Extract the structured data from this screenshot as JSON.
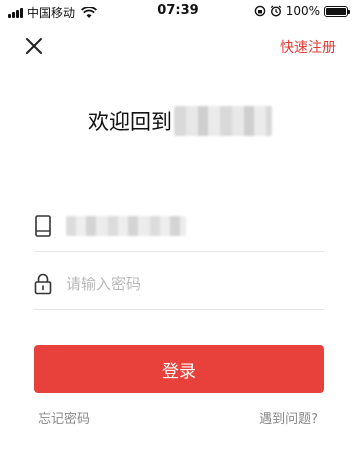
{
  "status_bar": {
    "carrier": "中国移动",
    "time": "07:39",
    "battery": "100%",
    "battery_level": 1.0
  },
  "nav": {
    "close_icon": "close-icon",
    "register_label": "快速注册"
  },
  "welcome": {
    "text": "欢迎回到"
  },
  "form": {
    "phone_icon": "phone-icon",
    "password_icon": "lock-icon",
    "password_placeholder": "请输入密码",
    "login_label": "登录"
  },
  "footer": {
    "forgot_label": "忘记密码",
    "help_label": "遇到问题?"
  },
  "colors": {
    "accent": "#e8403b",
    "link_red": "#e53935",
    "muted": "#888888"
  }
}
